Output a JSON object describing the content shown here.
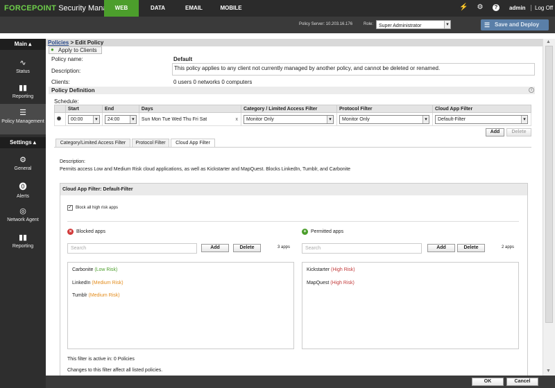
{
  "topbar": {
    "brand": "FORCEPOINT",
    "product": "Security Manager",
    "tabs": [
      {
        "label": "WEB",
        "active": true
      },
      {
        "label": "DATA",
        "active": false
      },
      {
        "label": "EMAIL",
        "active": false
      },
      {
        "label": "MOBILE",
        "active": false
      }
    ],
    "user": "admin",
    "logoff": "Log Off",
    "icons": [
      "plug-icon",
      "gear-icon",
      "help-icon"
    ]
  },
  "subbar": {
    "policy_server": "Policy Server: 10.203.16.176",
    "role_label": "Role:",
    "role_value": "Super Administrator",
    "save_deploy": "Save and Deploy"
  },
  "sidebar": {
    "main_label": "Main",
    "settings_label": "Settings",
    "main_items": [
      {
        "label": "Status",
        "icon": "pulse-icon"
      },
      {
        "label": "Reporting",
        "icon": "bar-chart-icon"
      },
      {
        "label": "Policy Management",
        "icon": "list-icon",
        "active": true
      }
    ],
    "settings_items": [
      {
        "label": "General",
        "icon": "gear-icon"
      },
      {
        "label": "Alerts",
        "icon": "alert-icon"
      },
      {
        "label": "Network Agent",
        "icon": "network-icon"
      },
      {
        "label": "Reporting",
        "icon": "report-icon"
      }
    ]
  },
  "breadcrumb": {
    "link": "Policies",
    "current": "> Edit Policy"
  },
  "apply_clients": "Apply to Clients",
  "policy": {
    "name_label": "Policy name:",
    "name_value": "Default",
    "desc_label": "Description:",
    "desc_value": "This policy applies to any client not currently managed by another policy, and cannot be deleted or renamed.",
    "clients_label": "Clients:",
    "clients_value": "0 users   0 networks   0 computers"
  },
  "definition": {
    "heading": "Policy Definition",
    "schedule_label": "Schedule:",
    "columns": [
      "Start",
      "End",
      "Days",
      "Category / Limited Access Filter",
      "Protocol Filter",
      "Cloud App Filter"
    ],
    "row": {
      "start": "00:00",
      "end": "24:00",
      "days": "Sun Mon Tue Wed Thu Fri Sat",
      "clear": "x",
      "category": "Monitor Only",
      "protocol": "Monitor Only",
      "cloud": "Default-Filter"
    },
    "add": "Add",
    "delete": "Delete"
  },
  "tabs": [
    "Category/Limited Access Filter",
    "Protocol Filter",
    "Cloud App Filter"
  ],
  "cloud_filter": {
    "desc_label": "Description:",
    "desc_text": "Permits access Low and Medium Risk cloud applications, as well as Kickstarter and MapQuest. Blocks LinkedIn, Tumblr, and Carbonite",
    "panel_title": "Cloud App Filter: Default-Filter",
    "block_high": "Block all high risk apps",
    "blocked": {
      "title": "Blocked apps",
      "search_placeholder": "Search",
      "add": "Add",
      "delete": "Delete",
      "count": "3  apps",
      "apps": [
        {
          "name": "Carbonite",
          "risk": "(Low Risk)",
          "level": "low"
        },
        {
          "name": "LinkedIn",
          "risk": "(Medium Risk)",
          "level": "med"
        },
        {
          "name": "Tumblr",
          "risk": "(Medium Risk)",
          "level": "med"
        }
      ]
    },
    "permitted": {
      "title": "Permitted apps",
      "search_placeholder": "Search",
      "add": "Add",
      "delete": "Delete",
      "count": "2  apps",
      "apps": [
        {
          "name": "Kickstarter",
          "risk": "(High Risk)",
          "level": "high"
        },
        {
          "name": "MapQuest",
          "risk": "(High Risk)",
          "level": "high"
        }
      ]
    },
    "active_in": "This filter is active in: 0 Policies",
    "changes_note": "Changes to this filter affect all listed policies."
  },
  "footer": {
    "ok": "OK",
    "cancel": "Cancel"
  },
  "colors": {
    "accent_green": "#4c9e2c",
    "deploy_blue": "#5a7fa8"
  }
}
